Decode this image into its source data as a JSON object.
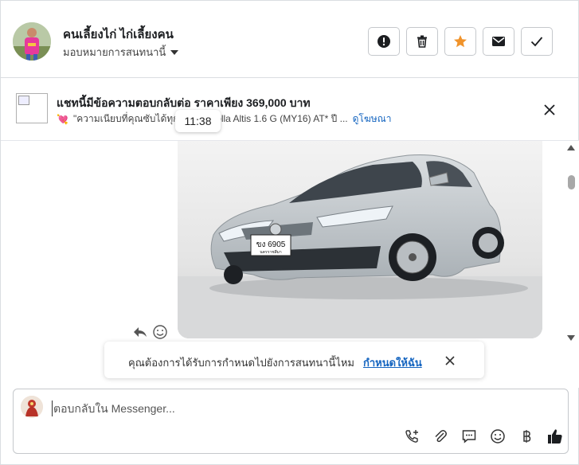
{
  "header": {
    "contact_name": "คนเลี้ยงไก่ ไก่เลี้ยงคน",
    "assign_label": "มอบหมายการสนทนานี้",
    "actions": [
      {
        "name": "flag-spam-button",
        "icon": "exclamation-icon"
      },
      {
        "name": "delete-button",
        "icon": "trash-icon"
      },
      {
        "name": "star-button",
        "icon": "star-icon"
      },
      {
        "name": "mark-unread-button",
        "icon": "envelope-icon"
      },
      {
        "name": "mark-done-button",
        "icon": "check-icon"
      }
    ],
    "star_color": "#f0932b"
  },
  "ad_banner": {
    "title": "แชทนี้มีข้อความตอบกลับต่อ ราคาเพียง 369,000 บาท",
    "subtitle_emoji": "💘",
    "subtitle_left": "\"ความเนียบที่คุณซับได้ทุกว",
    "subtitle_right": "olla Altis 1.6 G (MY16) AT* ปี ...",
    "link": "ดูโฆษณา"
  },
  "tooltip": {
    "time": "11:38"
  },
  "message": {
    "plate_number": "ขง 6905",
    "plate_province": "นครราชสีมา"
  },
  "reminder": {
    "text": "คุณต้องการได้รับการกำหนดไปยังการสนทนานี้ไหม",
    "link": "กำหนดให้ฉัน"
  },
  "composer": {
    "placeholder": "ตอบกลับใน Messenger...",
    "tools": [
      "call-add-icon",
      "paperclip-icon",
      "saved-reply-icon",
      "emoji-icon",
      "baht-icon",
      "thumbs-up-icon"
    ]
  },
  "colors": {
    "link": "#1565c0",
    "border": "#dadde1"
  }
}
